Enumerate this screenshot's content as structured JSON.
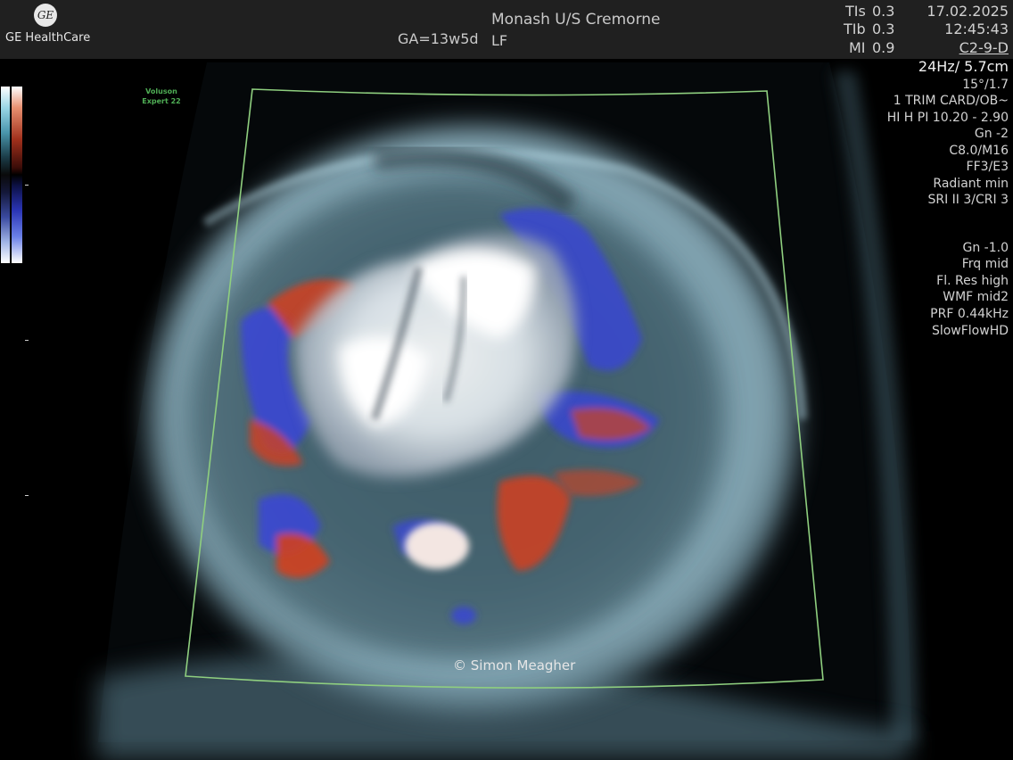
{
  "header": {
    "logo_mark": "GE",
    "logo_text": "GE HealthCare",
    "gestational_age": "GA=13w5d",
    "site": "Monash U/S Cremorne",
    "probe": "LF",
    "thermal": [
      {
        "label": "TIs",
        "value": "0.3"
      },
      {
        "label": "TIb",
        "value": "0.3"
      },
      {
        "label": "MI",
        "value": "0.9"
      }
    ],
    "date": "17.02.2025",
    "time": "12:45:43",
    "preset": "C2-9-D"
  },
  "brand": {
    "line1": "Voluson",
    "line2": "Expert 22"
  },
  "params": {
    "frame_rate": "24Hz/ 5.7cm",
    "angle": "15°/1.7",
    "application": "1 TRIM CARD/OB~",
    "harmonic": "HI H PI 10.20 - 2.90",
    "gain": "Gn  -2",
    "dynamic": "C8.0/M16",
    "filters": "FF3/E3",
    "radiant": "Radiant min",
    "sri": "SRI II 3/CRI 3",
    "color_gain": "Gn -1.0",
    "frequency": "Frq mid",
    "flow_res": "Fl. Res high",
    "wmf": "WMF mid2",
    "prf": "PRF 0.44kHz",
    "mode": "SlowFlowHD"
  },
  "colors": {
    "header_bg": "#202020",
    "roi_box": "#8fcf7f",
    "flow_red": "#d2401e",
    "flow_blue": "#3a46d8",
    "tissue": "#8ab4c4"
  },
  "watermark": "© Simon Meagher"
}
